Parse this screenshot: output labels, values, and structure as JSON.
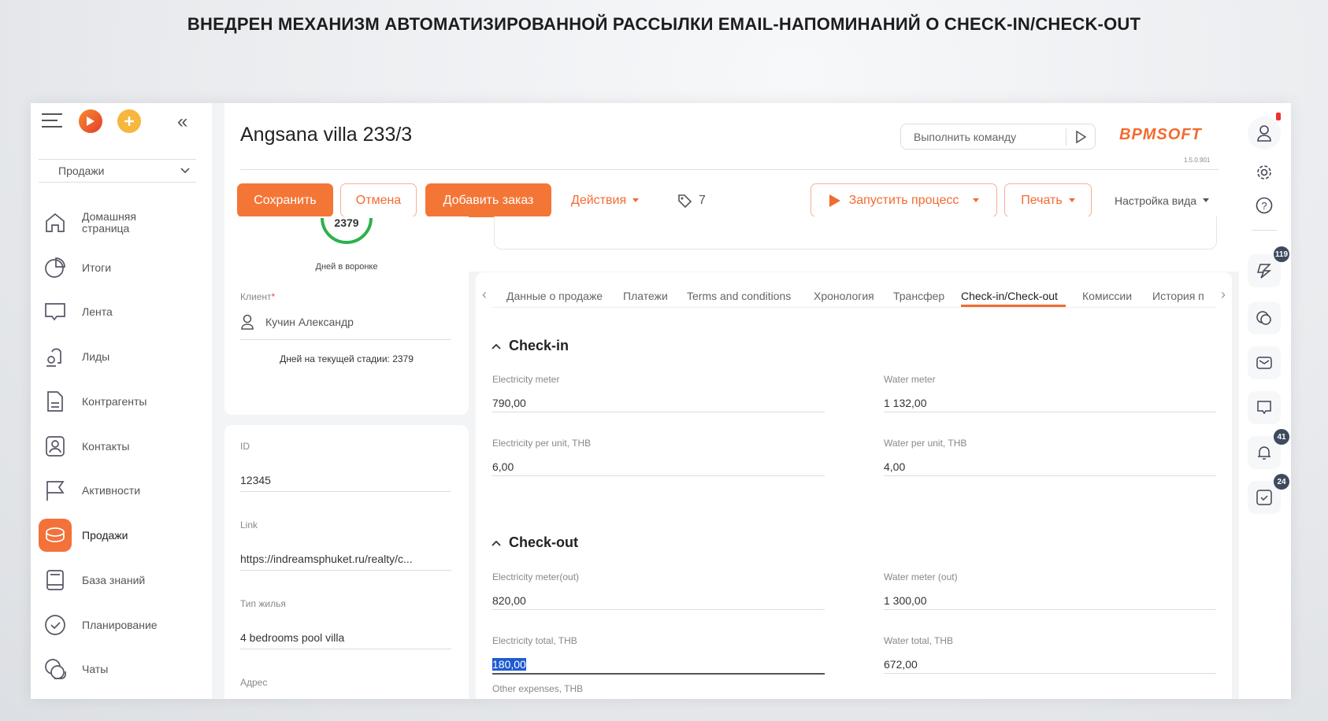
{
  "banner": "ВНЕДРЕН МЕХАНИЗМ АВТОМАТИЗИРОВАННОЙ РАССЫЛКИ EMAIL-НАПОМИНАНИЙ О CHECK-IN/CHECK-OUT",
  "sidebar": {
    "section": "Продажи",
    "items": [
      {
        "label": "Домашняя страница",
        "icon": "home-icon"
      },
      {
        "label": "Итоги",
        "icon": "pie-chart-icon"
      },
      {
        "label": "Лента",
        "icon": "feed-icon"
      },
      {
        "label": "Лиды",
        "icon": "leads-icon"
      },
      {
        "label": "Контрагенты",
        "icon": "document-icon"
      },
      {
        "label": "Контакты",
        "icon": "contact-icon"
      },
      {
        "label": "Активности",
        "icon": "flag-icon"
      },
      {
        "label": "Продажи",
        "icon": "sales-icon",
        "active": true
      },
      {
        "label": "База знаний",
        "icon": "book-icon"
      },
      {
        "label": "Планирование",
        "icon": "check-circle-icon"
      },
      {
        "label": "Чаты",
        "icon": "chats-icon"
      }
    ]
  },
  "header": {
    "title": "Angsana villa 233/3",
    "command_placeholder": "Выполнить команду",
    "logo": "BPMSOFT",
    "version": "1.5.0.901"
  },
  "toolbar": {
    "save": "Сохранить",
    "cancel": "Отмена",
    "add_order": "Добавить заказ",
    "actions": "Действия",
    "tags_count": "7",
    "run_process": "Запустить процесс",
    "print": "Печать",
    "view_settings": "Настройка вида"
  },
  "left": {
    "days_in_funnel": "2379",
    "days_in_funnel_label": "Дней в воронке",
    "client_label": "Клиент",
    "client": "Кучин Александр",
    "days_current_stage": "Дней на текущей стадии:  2379",
    "id_label": "ID",
    "id": "12345",
    "link_label": "Link",
    "link": "https://indreamsphuket.ru/realty/c...",
    "housing_label": "Тип жилья",
    "housing": "4 bedrooms pool villa",
    "address_label": "Адрес"
  },
  "tabs": [
    "Данные о продаже",
    "Платежи",
    "Terms and conditions",
    "Хронология",
    "Трансфер",
    "Check-in/Check-out",
    "Комиссии",
    "История п"
  ],
  "checkin": {
    "title": "Check-in",
    "fields": [
      {
        "label": "Electricity meter",
        "value": "790,00"
      },
      {
        "label": "Water meter",
        "value": "1 132,00"
      },
      {
        "label": "Electricity per unit, THB",
        "value": "6,00"
      },
      {
        "label": "Water per unit, THB",
        "value": "4,00"
      }
    ]
  },
  "checkout": {
    "title": "Check-out",
    "fields": [
      {
        "label": "Electricity meter(out)",
        "value": "820,00"
      },
      {
        "label": "Water meter (out)",
        "value": "1 300,00"
      },
      {
        "label": "Electricity total, THB",
        "value": "180,00"
      },
      {
        "label": "Water total, THB",
        "value": "672,00"
      }
    ],
    "next_label": "Other expenses, THB"
  },
  "rail": {
    "badges": {
      "feed": "119",
      "notifications": "41",
      "tasks": "24"
    }
  },
  "colors": {
    "accent": "#f47637",
    "badge": "#3e4a5e"
  }
}
